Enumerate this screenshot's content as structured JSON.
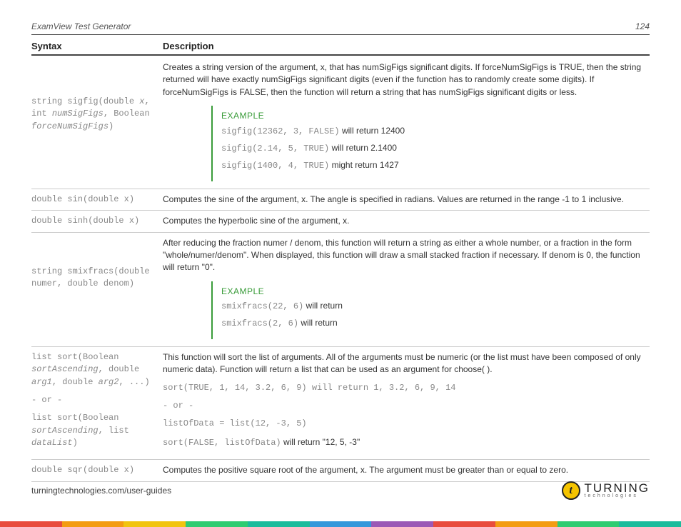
{
  "header": {
    "title": "ExamView Test Generator",
    "page": "124"
  },
  "columns": {
    "syntax": "Syntax",
    "description": "Description"
  },
  "rows": {
    "sigfig": {
      "syntax_pre": "string sigfig(double ",
      "syntax_p1": "x",
      "syntax_mid1": ", int ",
      "syntax_p2": "numSigFigs",
      "syntax_mid2": ", Boolean ",
      "syntax_p3": "forceNumSigFigs",
      "syntax_post": ")",
      "desc": "Creates a string version of the argument, x, that has numSigFigs significant digits. If forceNumSigFigs is TRUE, then the string returned will have exactly numSigFigs significant digits (even if the function has to randomly create some digits). If forceNumSigFigs is FALSE, then the function will return a string that has numSigFigs significant digits or less.",
      "example_label": "EXAMPLE",
      "ex1_code": "sigfig(12362, 3, FALSE)",
      "ex1_text": " will return 12400",
      "ex2_code": "sigfig(2.14, 5, TRUE)",
      "ex2_text": " will return 2.1400",
      "ex3_code": "sigfig(1400, 4, TRUE)",
      "ex3_text": " might return 1427"
    },
    "sin": {
      "syntax": "double sin(double x)",
      "desc": "Computes the sine of the argument, x. The angle is specified in radians. Values are returned in the range -1 to 1 inclusive."
    },
    "sinh": {
      "syntax": "double sinh(double x)",
      "desc": "Computes the hyperbolic sine of the argument, x."
    },
    "smixfracs": {
      "syntax": "string smixfracs(double numer, double denom)",
      "desc": "After reducing the fraction numer / denom, this function will return a string as either a whole number, or a fraction in the form \"whole/numer/denom\". When displayed, this function will draw a small stacked fraction if necessary. If denom is 0, the function will return \"0\".",
      "example_label": "EXAMPLE",
      "ex1_code": "smixfracs(22, 6)",
      "ex1_text": " will return",
      "ex2_code": "smixfracs(2, 6)",
      "ex2_text": " will return"
    },
    "sort": {
      "syntax1_pre": "list sort(Boolean ",
      "syntax1_p1": "sortAscending",
      "syntax1_mid1": ", double ",
      "syntax1_p2": "arg1",
      "syntax1_mid2": ", double ",
      "syntax1_p3": "arg2",
      "syntax1_post": ", ...)",
      "or": "- or -",
      "syntax2_pre": "list sort(Boolean ",
      "syntax2_p1": "sortAscending",
      "syntax2_mid": ", list ",
      "syntax2_p2": "dataList",
      "syntax2_post": ")",
      "desc": "This function will sort the list of arguments. All of the arguments must be numeric (or the list must have been composed of only numeric data). Function will return a list that can be used as an argument for choose( ).",
      "line1": "sort(TRUE, 1, 14, 3.2, 6, 9) will return 1, 3.2, 6, 9, 14",
      "or2": "- or -",
      "line2": "listOfData = list(12, -3, 5)",
      "line3_code": "sort(FALSE, listOfData)",
      "line3_text": " will return  \"12, 5, -3\""
    },
    "sqr": {
      "syntax": "double sqr(double x)",
      "desc": "Computes the positive square root of the argument, x. The argument must be greater than or equal to zero."
    }
  },
  "footer": {
    "url": "turningtechnologies.com/user-guides",
    "logo_top": "TURNING",
    "logo_bot": "technologies",
    "logo_letter": "t"
  }
}
